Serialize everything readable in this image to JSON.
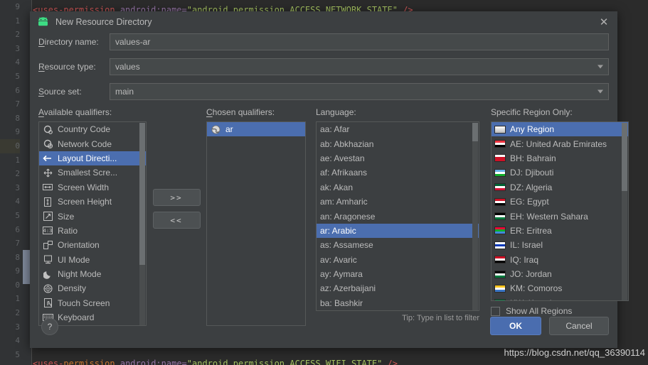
{
  "background": {
    "code_line_top": "<uses-permission android:name=\"android.permission.ACCESS_NETWORK_STATE\" />",
    "code_line_bottom": "<uses-permission android:name=\"android.permission.ACCESS_WIFI_STATE\" />",
    "gutter_numbers": [
      "9",
      "1",
      "2",
      "3",
      "4",
      "5",
      "6",
      "7",
      "8",
      "9",
      "0",
      "1",
      "2",
      "3",
      "4",
      "5",
      "6",
      "7",
      "8",
      "9",
      "0",
      "1",
      "2",
      "3",
      "4",
      "5"
    ]
  },
  "dialog": {
    "title": "New Resource Directory",
    "icon": "android-droid-icon",
    "close_label": "✕",
    "fields": [
      {
        "label": "Directory name:",
        "mnemonic": "D",
        "rest": "irectory name:",
        "value": "values-ar",
        "type": "text"
      },
      {
        "label": "Resource type:",
        "mnemonic": "R",
        "rest": "esource type:",
        "value": "values",
        "type": "combo"
      },
      {
        "label": "Source set:",
        "mnemonic": "S",
        "rest": "ource set:",
        "value": "main",
        "type": "combo"
      }
    ],
    "available": {
      "heading_mnemonic": "A",
      "heading_rest": "vailable qualifiers:",
      "heading": "Available qualifiers:",
      "items": [
        {
          "label": "Country Code",
          "icon": "country-code-icon",
          "selected": false
        },
        {
          "label": "Network Code",
          "icon": "network-code-icon",
          "selected": false
        },
        {
          "label": "Layout Directi...",
          "icon": "layout-direction-icon",
          "selected": true
        },
        {
          "label": "Smallest Scre...",
          "icon": "smallest-screen-icon",
          "selected": false
        },
        {
          "label": "Screen Width",
          "icon": "screen-width-icon",
          "selected": false
        },
        {
          "label": "Screen Height",
          "icon": "screen-height-icon",
          "selected": false
        },
        {
          "label": "Size",
          "icon": "size-icon",
          "selected": false
        },
        {
          "label": "Ratio",
          "icon": "ratio-icon",
          "selected": false
        },
        {
          "label": "Orientation",
          "icon": "orientation-icon",
          "selected": false
        },
        {
          "label": "UI Mode",
          "icon": "ui-mode-icon",
          "selected": false
        },
        {
          "label": "Night Mode",
          "icon": "night-mode-icon",
          "selected": false
        },
        {
          "label": "Density",
          "icon": "density-icon",
          "selected": false
        },
        {
          "label": "Touch Screen",
          "icon": "touch-screen-icon",
          "selected": false
        },
        {
          "label": "Keyboard",
          "icon": "keyboard-icon",
          "selected": false
        }
      ]
    },
    "move_buttons": {
      "add": ">>",
      "remove": "<<"
    },
    "chosen": {
      "heading_mnemonic": "C",
      "heading_pre": "C",
      "heading_rest": "hosen qualifiers:",
      "heading": "Chosen qualifiers:",
      "items": [
        {
          "label": "ar",
          "icon": "globe-icon",
          "selected": true
        }
      ]
    },
    "language": {
      "heading": "Language:",
      "tip": "Tip: Type in list to filter",
      "items": [
        {
          "label": "aa: Afar",
          "selected": false
        },
        {
          "label": "ab: Abkhazian",
          "selected": false
        },
        {
          "label": "ae: Avestan",
          "selected": false
        },
        {
          "label": "af: Afrikaans",
          "selected": false
        },
        {
          "label": "ak: Akan",
          "selected": false
        },
        {
          "label": "am: Amharic",
          "selected": false
        },
        {
          "label": "an: Aragonese",
          "selected": false
        },
        {
          "label": "ar: Arabic",
          "selected": true
        },
        {
          "label": "as: Assamese",
          "selected": false
        },
        {
          "label": "av: Avaric",
          "selected": false
        },
        {
          "label": "ay: Aymara",
          "selected": false
        },
        {
          "label": "az: Azerbaijani",
          "selected": false
        },
        {
          "label": "ba: Bashkir",
          "selected": false
        }
      ]
    },
    "region": {
      "heading": "Specific Region Only:",
      "show_all_label": "Show All Regions",
      "show_all_checked": false,
      "items": [
        {
          "label": "Any Region",
          "selected": true,
          "flag": [
            "#f0f0f0",
            "#dcdcdc",
            "#c8c8c8"
          ]
        },
        {
          "label": "AE: United Arab Emirates",
          "selected": false,
          "flag": [
            "#ef3340",
            "#ffffff",
            "#000000"
          ]
        },
        {
          "label": "BH: Bahrain",
          "selected": false,
          "flag": [
            "#ffffff",
            "#ce1126",
            "#ce1126"
          ]
        },
        {
          "label": "DJ: Djibouti",
          "selected": false,
          "flag": [
            "#6ab2e7",
            "#ffffff",
            "#12ad2b"
          ]
        },
        {
          "label": "DZ: Algeria",
          "selected": false,
          "flag": [
            "#006233",
            "#ffffff",
            "#d21034"
          ]
        },
        {
          "label": "EG: Egypt",
          "selected": false,
          "flag": [
            "#ce1126",
            "#ffffff",
            "#000000"
          ]
        },
        {
          "label": "EH: Western Sahara",
          "selected": false,
          "flag": [
            "#000000",
            "#ffffff",
            "#007a3d"
          ]
        },
        {
          "label": "ER: Eritrea",
          "selected": false,
          "flag": [
            "#ea0437",
            "#12ad2b",
            "#4189dd"
          ]
        },
        {
          "label": "IL: Israel",
          "selected": false,
          "flag": [
            "#ffffff",
            "#0038b8",
            "#ffffff"
          ]
        },
        {
          "label": "IQ: Iraq",
          "selected": false,
          "flag": [
            "#ce1126",
            "#ffffff",
            "#000000"
          ]
        },
        {
          "label": "JO: Jordan",
          "selected": false,
          "flag": [
            "#000000",
            "#ffffff",
            "#007a3d"
          ]
        },
        {
          "label": "KM: Comoros",
          "selected": false,
          "flag": [
            "#ffc61e",
            "#ffffff",
            "#3a75c4"
          ]
        },
        {
          "label": "KW: Kuwait",
          "selected": false,
          "flag": [
            "#007a3d",
            "#ffffff",
            "#ce1126"
          ]
        }
      ]
    },
    "footer": {
      "help": "?",
      "ok": "OK",
      "cancel": "Cancel"
    }
  },
  "watermark": "https://blog.csdn.net/qq_36390114",
  "colors": {
    "accent": "#4b6eaf",
    "dialog_bg": "#3c3f41",
    "field_bg": "#45494a",
    "text": "#bbbbbb"
  }
}
